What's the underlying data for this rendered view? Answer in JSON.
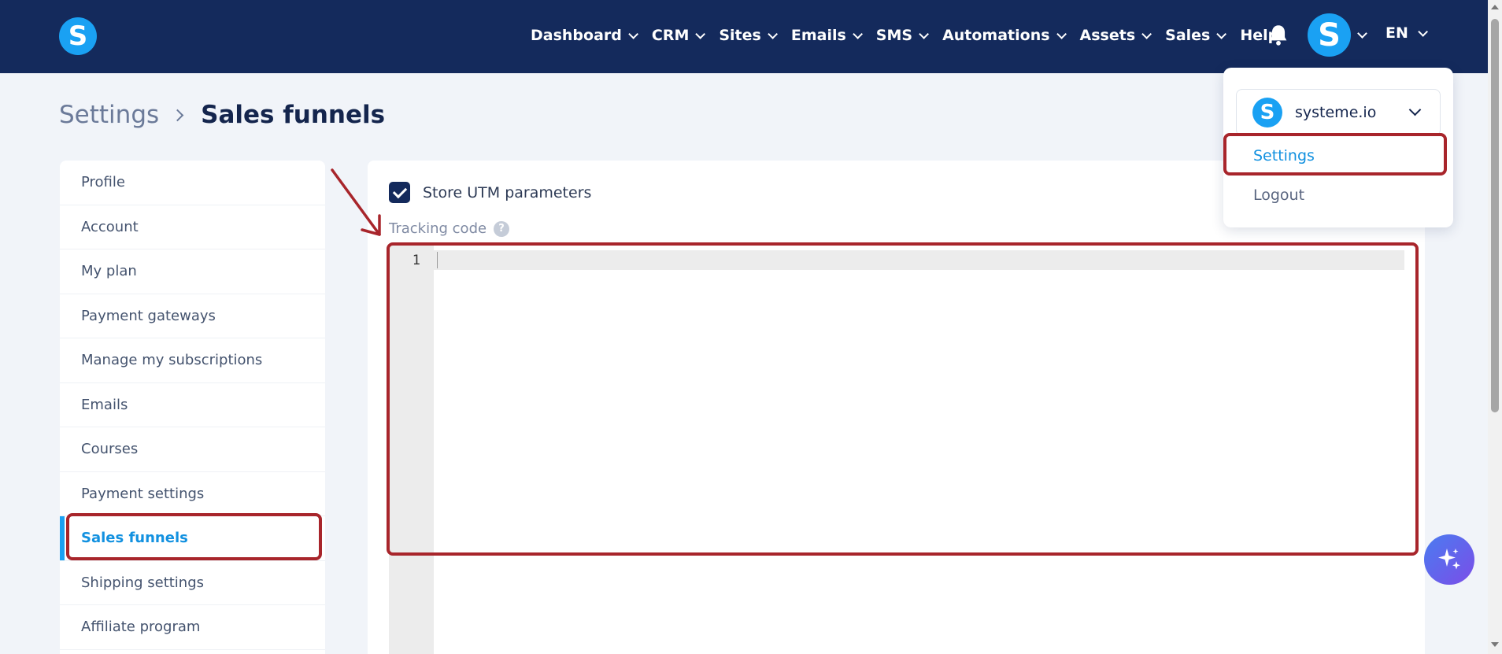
{
  "header": {
    "logo_letter": "S",
    "nav": [
      {
        "label": "Dashboard",
        "has_menu": true
      },
      {
        "label": "CRM",
        "has_menu": true
      },
      {
        "label": "Sites",
        "has_menu": true
      },
      {
        "label": "Emails",
        "has_menu": true
      },
      {
        "label": "SMS",
        "has_menu": true
      },
      {
        "label": "Automations",
        "has_menu": true
      },
      {
        "label": "Assets",
        "has_menu": true
      },
      {
        "label": "Sales",
        "has_menu": true
      },
      {
        "label": "Help",
        "has_menu": false
      }
    ],
    "avatar_letter": "S",
    "language": "EN"
  },
  "breadcrumb": {
    "root": "Settings",
    "current": "Sales funnels"
  },
  "sidebar": {
    "items": [
      {
        "label": "Profile",
        "active": false
      },
      {
        "label": "Account",
        "active": false
      },
      {
        "label": "My plan",
        "active": false
      },
      {
        "label": "Payment gateways",
        "active": false
      },
      {
        "label": "Manage my subscriptions",
        "active": false
      },
      {
        "label": "Emails",
        "active": false
      },
      {
        "label": "Courses",
        "active": false
      },
      {
        "label": "Payment settings",
        "active": false
      },
      {
        "label": "Sales funnels",
        "active": true
      },
      {
        "label": "Shipping settings",
        "active": false
      },
      {
        "label": "Affiliate program",
        "active": false
      }
    ]
  },
  "main": {
    "utm_label": "Store UTM parameters",
    "utm_checked": true,
    "tracking_label": "Tracking code",
    "help_glyph": "?",
    "editor": {
      "line_number": "1",
      "code": ""
    }
  },
  "dropdown": {
    "account_logo": "S",
    "account_name": "systeme.io",
    "settings_label": "Settings",
    "logout_label": "Logout"
  },
  "colors": {
    "nav_bg": "#142a5c",
    "brand_blue": "#1aa1f3",
    "link_blue": "#1291e0",
    "annotation_red": "#a8252b"
  },
  "icons": {
    "bell": "bell-icon",
    "fab": "sparkle-icon"
  }
}
